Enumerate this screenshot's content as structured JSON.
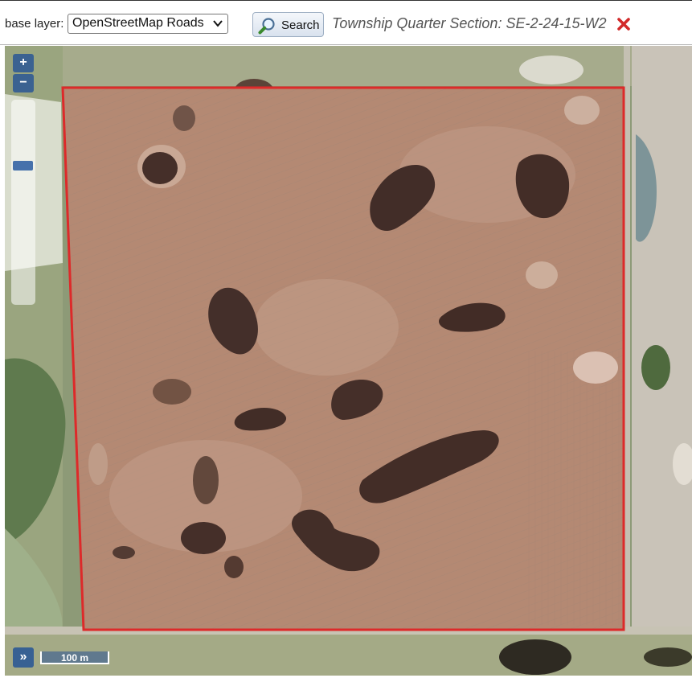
{
  "toolbar": {
    "base_layer_label": "base layer:",
    "base_layer_value": "OpenStreetMap Roads",
    "search_label": "Search",
    "section_title": "Township Quarter Section: SE-2-24-15-W2"
  },
  "map": {
    "zoom_in": "+",
    "zoom_out": "−",
    "layer_switcher": "»",
    "scale_label": "100 m",
    "boundary_color": "#dd2a2a"
  },
  "icons": {
    "search": "magnifier-icon",
    "close": "close-icon",
    "dropdown": "chevron-down-icon"
  }
}
